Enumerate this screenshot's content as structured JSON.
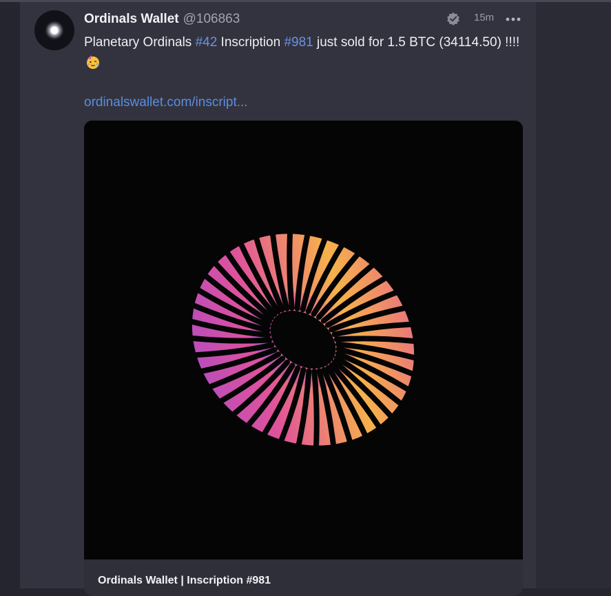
{
  "post": {
    "author_name": "Ordinals Wallet",
    "author_handle": "@106863",
    "timestamp": "15m",
    "text_before_tag1": "Planetary Ordinals ",
    "tag1": "#42",
    "text_mid": " Inscription ",
    "tag2": "#981",
    "text_after": " just sold for 1.5 BTC (34114.50) !!!!",
    "emoji": "partying-face",
    "link_text": "ordinalswallet.com/inscript...",
    "verified_icon": "verified-badge-icon",
    "more_icon": "more-options-icon"
  },
  "card": {
    "title": "Ordinals Wallet | Inscription #981",
    "art": "striped-torus-artwork"
  },
  "colors": {
    "accent_link": "#5b8ee0",
    "hashtag": "#6a93e6",
    "torus_orange": "#f7b24a",
    "torus_pink": "#e0529b",
    "torus_purple": "#a04ad0"
  }
}
